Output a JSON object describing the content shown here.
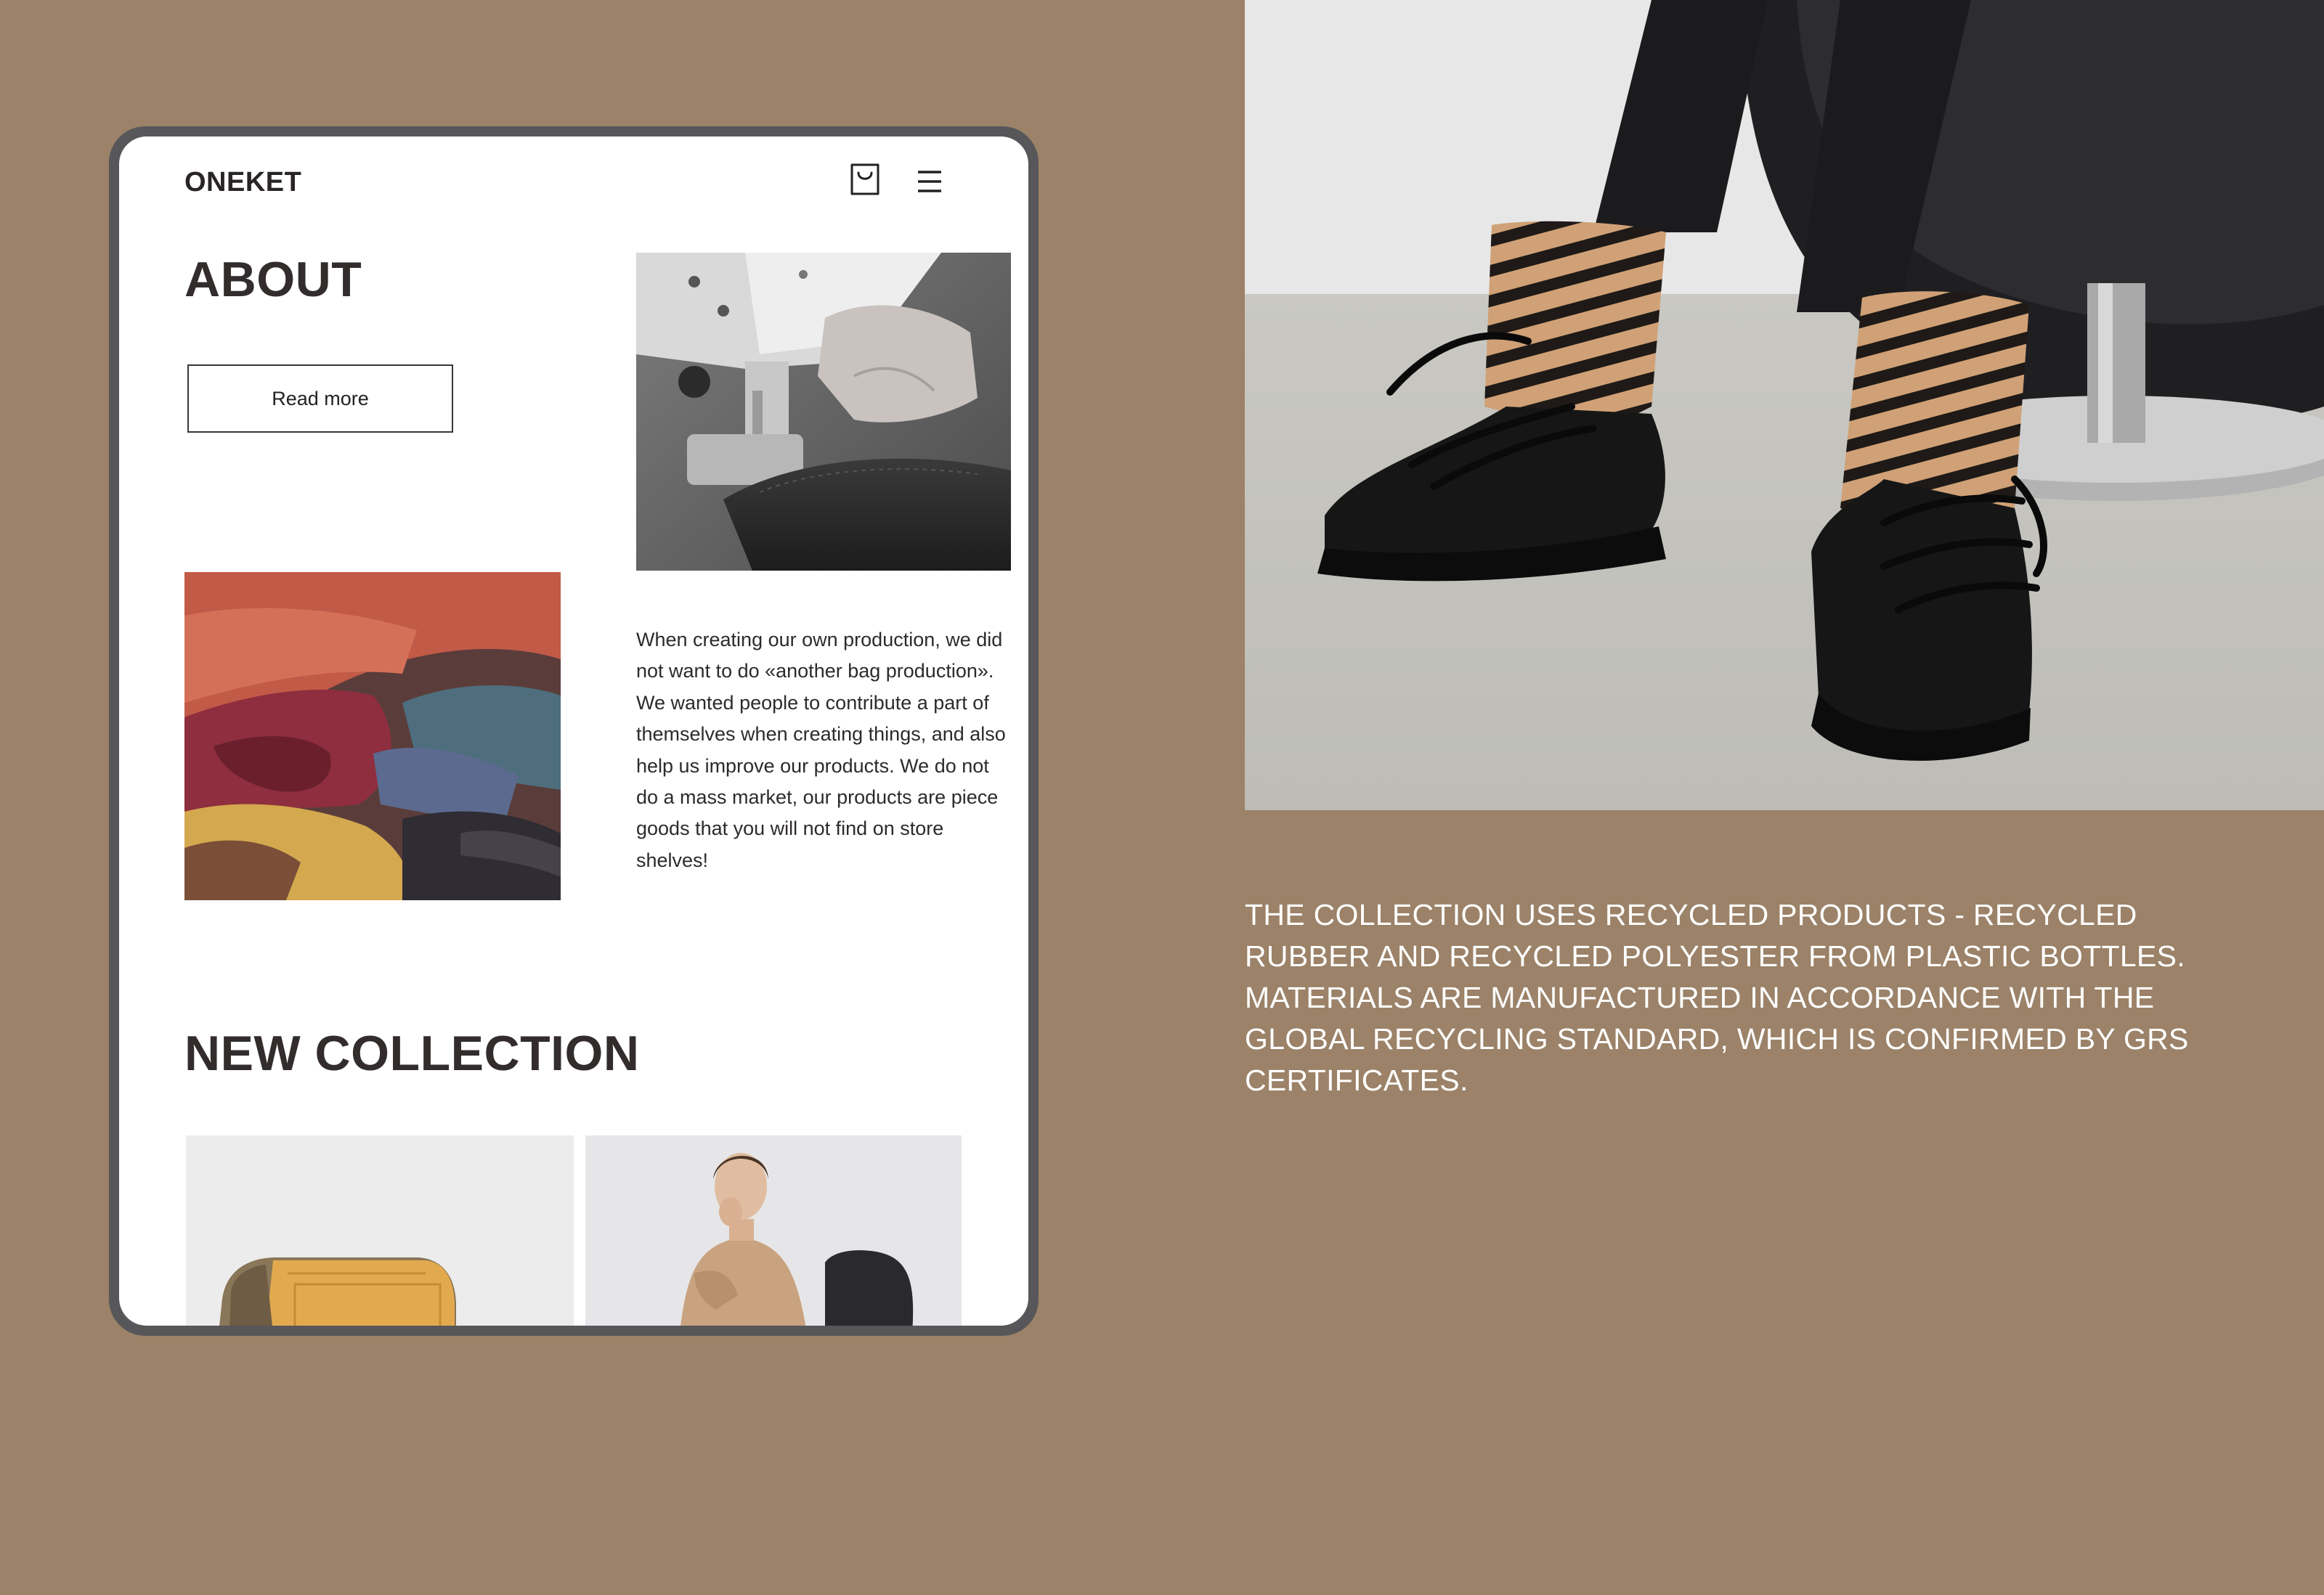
{
  "header": {
    "logo": "ONEKET",
    "cart_icon": "shopping-bag-icon",
    "menu_icon": "hamburger-menu-icon"
  },
  "about": {
    "title": "ABOUT",
    "read_more_label": "Read more",
    "text": "When creating our own production, we did not want to do «another bag production». We wanted people to contribute a part of themselves when creating things, and also help us improve our products. We do not do a mass market, our products are piece goods that you will not find on store shelves!"
  },
  "new_collection": {
    "title": "NEW COLLECTION"
  },
  "collection_description": "THE COLLECTION USES RECYCLED PRODUCTS - RECYCLED RUBBER AND RECYCLED POLYESTER FROM PLASTIC BOTTLES. MATERIALS ARE MANUFACTURED IN ACCORDANCE WITH THE GLOBAL RECYCLING STANDARD, WHICH IS CONFIRMED BY GRS CERTIFICATES.",
  "colors": {
    "background": "#9b8268",
    "device_frame": "#57575a",
    "screen": "#ffffff",
    "heading_text": "#332c2c",
    "description_text": "#ffffff"
  }
}
